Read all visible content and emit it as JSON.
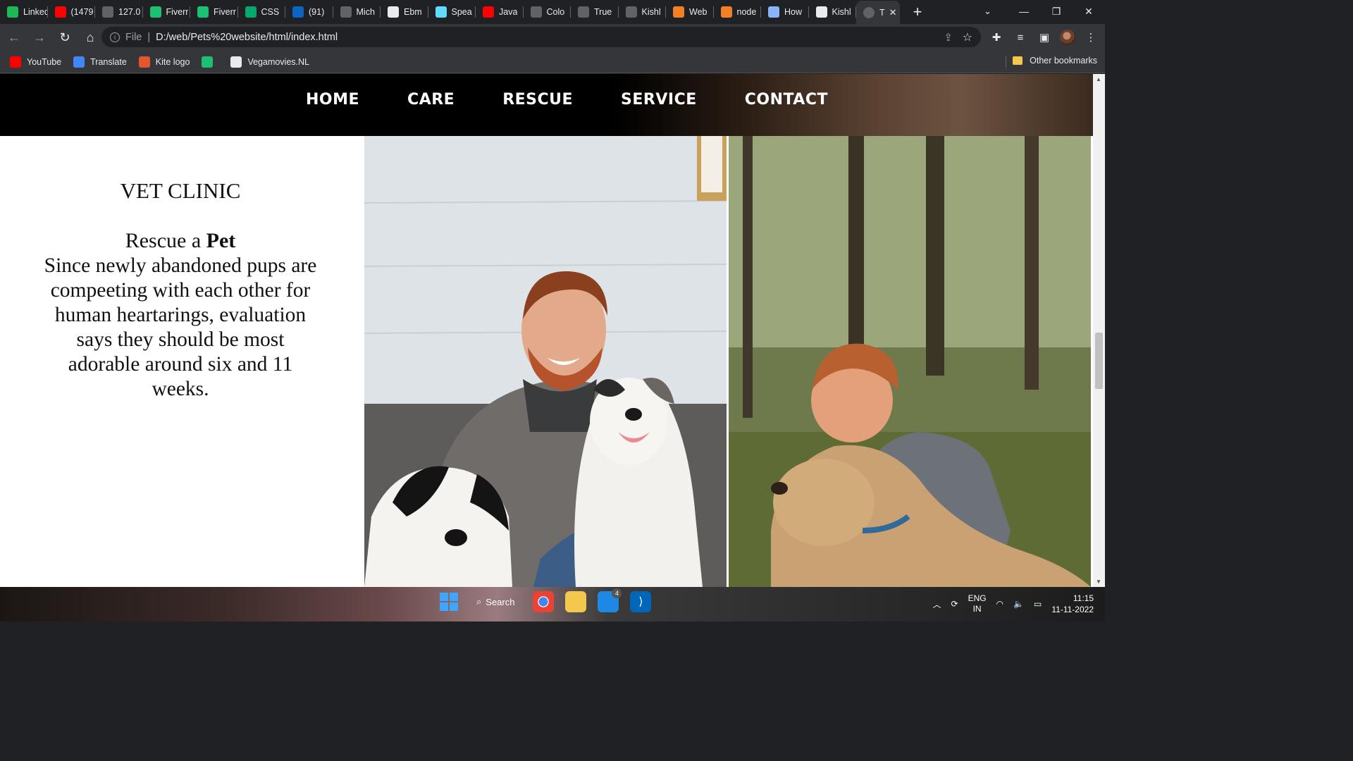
{
  "browser": {
    "tabs": [
      {
        "label": "LinkedIn",
        "icon": "green-square-icon",
        "color": "#1db954"
      },
      {
        "label": "(1479",
        "icon": "youtube-icon",
        "color": "#ff0000"
      },
      {
        "label": "127.0",
        "icon": "globe-icon",
        "color": "#5f6368"
      },
      {
        "label": "Fiverr",
        "icon": "fiverr-icon",
        "color": "#1dbf73"
      },
      {
        "label": "Fiverr",
        "icon": "fiverr-icon",
        "color": "#1dbf73"
      },
      {
        "label": "CSS",
        "icon": "w3-icon",
        "color": "#04aa6d"
      },
      {
        "label": "(91)",
        "icon": "linkedin-icon",
        "color": "#0a66c2"
      },
      {
        "label": "Mich",
        "icon": "globe-icon",
        "color": "#5f6368"
      },
      {
        "label": "Ebm",
        "icon": "github-icon",
        "color": "#e8eaed"
      },
      {
        "label": "Spea",
        "icon": "react-icon",
        "color": "#61dafb"
      },
      {
        "label": "Java",
        "icon": "youtube-icon",
        "color": "#ff0000"
      },
      {
        "label": "Colo",
        "icon": "globe-icon",
        "color": "#5f6368"
      },
      {
        "label": "True",
        "icon": "globe-icon",
        "color": "#5f6368"
      },
      {
        "label": "Kishl",
        "icon": "globe-icon",
        "color": "#5f6368"
      },
      {
        "label": "Web",
        "icon": "stackoverflow-icon",
        "color": "#f48024"
      },
      {
        "label": "node",
        "icon": "stackoverflow-icon",
        "color": "#f48024"
      },
      {
        "label": "How",
        "icon": "a-icon",
        "color": "#8ab4f8"
      },
      {
        "label": "Kishl",
        "icon": "github-icon",
        "color": "#e8eaed"
      }
    ],
    "active_tab_label": "T",
    "address": {
      "scheme": "File",
      "url": "D:/web/Pets%20website/html/index.html"
    },
    "bookmarks": [
      {
        "label": "YouTube",
        "icon": "youtube-icon",
        "color": "#ff0000"
      },
      {
        "label": "Translate",
        "icon": "translate-icon",
        "color": "#4285f4"
      },
      {
        "label": "Kite logo",
        "icon": "kite-icon",
        "color": "#e4572e"
      },
      {
        "label": "",
        "icon": "fiverr-icon",
        "color": "#1dbf73"
      },
      {
        "label": "Vegamovies.NL",
        "icon": "v-icon",
        "color": "#e8eaed"
      }
    ],
    "other_bookmarks": "Other bookmarks"
  },
  "site": {
    "nav": [
      "HOME",
      "CARE",
      "RESCUE",
      "SERVICE",
      "CONTACT"
    ],
    "clinic": {
      "title": "VET CLINIC",
      "rescue_prefix": "Rescue a ",
      "rescue_bold": "Pet",
      "body": "Since newly abandoned pups are compeeting with each other for human heartarings, evaluation says they should be most adorable around six and 11 weeks."
    }
  },
  "taskbar": {
    "search_label": "Search",
    "mail_badge": "4",
    "language": "ENG",
    "region": "IN",
    "time": "11:15",
    "date": "11-11-2022"
  }
}
